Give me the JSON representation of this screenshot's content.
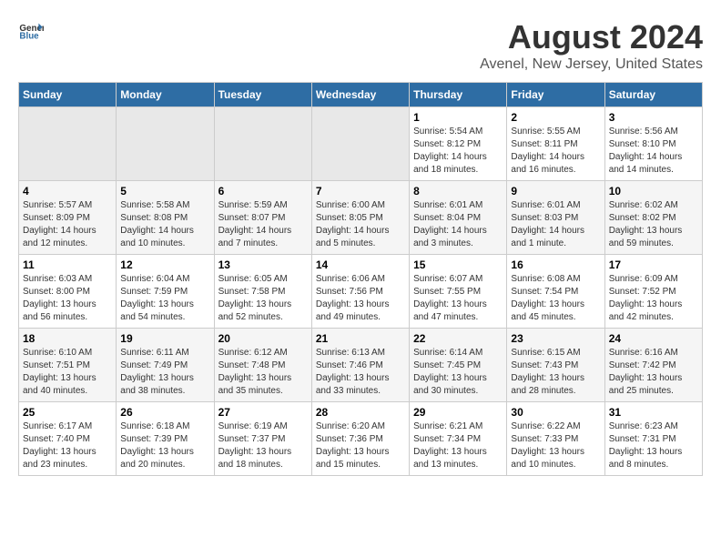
{
  "header": {
    "logo_general": "General",
    "logo_blue": "Blue",
    "main_title": "August 2024",
    "subtitle": "Avenel, New Jersey, United States"
  },
  "calendar": {
    "days_of_week": [
      "Sunday",
      "Monday",
      "Tuesday",
      "Wednesday",
      "Thursday",
      "Friday",
      "Saturday"
    ],
    "weeks": [
      {
        "days": [
          {
            "num": "",
            "info": "",
            "empty": true
          },
          {
            "num": "",
            "info": "",
            "empty": true
          },
          {
            "num": "",
            "info": "",
            "empty": true
          },
          {
            "num": "",
            "info": "",
            "empty": true
          },
          {
            "num": "1",
            "info": "Sunrise: 5:54 AM\nSunset: 8:12 PM\nDaylight: 14 hours\nand 18 minutes."
          },
          {
            "num": "2",
            "info": "Sunrise: 5:55 AM\nSunset: 8:11 PM\nDaylight: 14 hours\nand 16 minutes."
          },
          {
            "num": "3",
            "info": "Sunrise: 5:56 AM\nSunset: 8:10 PM\nDaylight: 14 hours\nand 14 minutes."
          }
        ]
      },
      {
        "days": [
          {
            "num": "4",
            "info": "Sunrise: 5:57 AM\nSunset: 8:09 PM\nDaylight: 14 hours\nand 12 minutes."
          },
          {
            "num": "5",
            "info": "Sunrise: 5:58 AM\nSunset: 8:08 PM\nDaylight: 14 hours\nand 10 minutes."
          },
          {
            "num": "6",
            "info": "Sunrise: 5:59 AM\nSunset: 8:07 PM\nDaylight: 14 hours\nand 7 minutes."
          },
          {
            "num": "7",
            "info": "Sunrise: 6:00 AM\nSunset: 8:05 PM\nDaylight: 14 hours\nand 5 minutes."
          },
          {
            "num": "8",
            "info": "Sunrise: 6:01 AM\nSunset: 8:04 PM\nDaylight: 14 hours\nand 3 minutes."
          },
          {
            "num": "9",
            "info": "Sunrise: 6:01 AM\nSunset: 8:03 PM\nDaylight: 14 hours\nand 1 minute."
          },
          {
            "num": "10",
            "info": "Sunrise: 6:02 AM\nSunset: 8:02 PM\nDaylight: 13 hours\nand 59 minutes."
          }
        ]
      },
      {
        "days": [
          {
            "num": "11",
            "info": "Sunrise: 6:03 AM\nSunset: 8:00 PM\nDaylight: 13 hours\nand 56 minutes."
          },
          {
            "num": "12",
            "info": "Sunrise: 6:04 AM\nSunset: 7:59 PM\nDaylight: 13 hours\nand 54 minutes."
          },
          {
            "num": "13",
            "info": "Sunrise: 6:05 AM\nSunset: 7:58 PM\nDaylight: 13 hours\nand 52 minutes."
          },
          {
            "num": "14",
            "info": "Sunrise: 6:06 AM\nSunset: 7:56 PM\nDaylight: 13 hours\nand 49 minutes."
          },
          {
            "num": "15",
            "info": "Sunrise: 6:07 AM\nSunset: 7:55 PM\nDaylight: 13 hours\nand 47 minutes."
          },
          {
            "num": "16",
            "info": "Sunrise: 6:08 AM\nSunset: 7:54 PM\nDaylight: 13 hours\nand 45 minutes."
          },
          {
            "num": "17",
            "info": "Sunrise: 6:09 AM\nSunset: 7:52 PM\nDaylight: 13 hours\nand 42 minutes."
          }
        ]
      },
      {
        "days": [
          {
            "num": "18",
            "info": "Sunrise: 6:10 AM\nSunset: 7:51 PM\nDaylight: 13 hours\nand 40 minutes."
          },
          {
            "num": "19",
            "info": "Sunrise: 6:11 AM\nSunset: 7:49 PM\nDaylight: 13 hours\nand 38 minutes."
          },
          {
            "num": "20",
            "info": "Sunrise: 6:12 AM\nSunset: 7:48 PM\nDaylight: 13 hours\nand 35 minutes."
          },
          {
            "num": "21",
            "info": "Sunrise: 6:13 AM\nSunset: 7:46 PM\nDaylight: 13 hours\nand 33 minutes."
          },
          {
            "num": "22",
            "info": "Sunrise: 6:14 AM\nSunset: 7:45 PM\nDaylight: 13 hours\nand 30 minutes."
          },
          {
            "num": "23",
            "info": "Sunrise: 6:15 AM\nSunset: 7:43 PM\nDaylight: 13 hours\nand 28 minutes."
          },
          {
            "num": "24",
            "info": "Sunrise: 6:16 AM\nSunset: 7:42 PM\nDaylight: 13 hours\nand 25 minutes."
          }
        ]
      },
      {
        "days": [
          {
            "num": "25",
            "info": "Sunrise: 6:17 AM\nSunset: 7:40 PM\nDaylight: 13 hours\nand 23 minutes."
          },
          {
            "num": "26",
            "info": "Sunrise: 6:18 AM\nSunset: 7:39 PM\nDaylight: 13 hours\nand 20 minutes."
          },
          {
            "num": "27",
            "info": "Sunrise: 6:19 AM\nSunset: 7:37 PM\nDaylight: 13 hours\nand 18 minutes."
          },
          {
            "num": "28",
            "info": "Sunrise: 6:20 AM\nSunset: 7:36 PM\nDaylight: 13 hours\nand 15 minutes."
          },
          {
            "num": "29",
            "info": "Sunrise: 6:21 AM\nSunset: 7:34 PM\nDaylight: 13 hours\nand 13 minutes."
          },
          {
            "num": "30",
            "info": "Sunrise: 6:22 AM\nSunset: 7:33 PM\nDaylight: 13 hours\nand 10 minutes."
          },
          {
            "num": "31",
            "info": "Sunrise: 6:23 AM\nSunset: 7:31 PM\nDaylight: 13 hours\nand 8 minutes."
          }
        ]
      }
    ]
  }
}
